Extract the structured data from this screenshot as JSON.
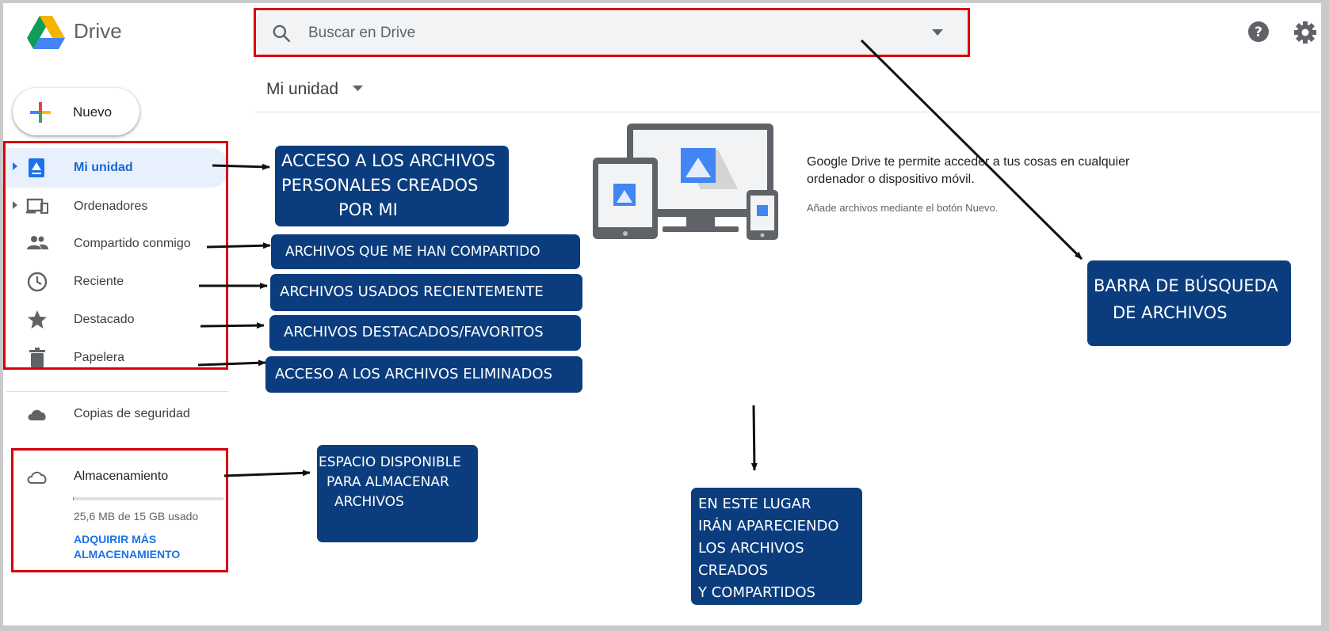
{
  "header": {
    "app_name": "Drive",
    "search_placeholder": "Buscar en Drive"
  },
  "new_button": {
    "label": "Nuevo"
  },
  "sidebar": {
    "items": [
      {
        "label": "Mi unidad",
        "icon": "my-drive-icon",
        "active": true
      },
      {
        "label": "Ordenadores",
        "icon": "computers-icon"
      },
      {
        "label": "Compartido conmigo",
        "icon": "shared-people-icon"
      },
      {
        "label": "Reciente",
        "icon": "clock-icon"
      },
      {
        "label": "Destacado",
        "icon": "star-icon"
      },
      {
        "label": "Papelera",
        "icon": "trash-icon"
      }
    ],
    "backups": {
      "label": "Copias de seguridad",
      "icon": "cloud-icon"
    },
    "storage": {
      "label": "Almacenamiento",
      "icon": "cloud-outline-icon",
      "usage_text": "25,6 MB de 15 GB usado",
      "used_fraction": 0.0017,
      "upgrade_line1": "ADQUIRIR MÁS",
      "upgrade_line2": "ALMACENAMIENTO"
    }
  },
  "main": {
    "breadcrumb": "Mi unidad",
    "empty_state": {
      "description": "Google Drive te permite acceder a tus cosas en cualquier ordenador o dispositivo móvil.",
      "hint": "Añade archivos mediante el botón Nuevo."
    }
  },
  "annotations": {
    "mydrive": [
      "ACCESO A LOS ARCHIVOS",
      "PERSONALES CREADOS",
      "POR MI"
    ],
    "shared": "ARCHIVOS QUE ME HAN COMPARTIDO",
    "recent": "ARCHIVOS USADOS RECIENTEMENTE",
    "starred": "ARCHIVOS DESTACADOS/FAVORITOS",
    "trash": "ACCESO A LOS ARCHIVOS ELIMINADOS",
    "storage": [
      "ESPACIO DISPONIBLE",
      "PARA ALMACENAR",
      "ARCHIVOS"
    ],
    "search": [
      "BARRA DE BÚSQUEDA",
      "DE ARCHIVOS"
    ],
    "files_area": [
      "EN ESTE LUGAR",
      "IRÁN APARECIENDO",
      "LOS ARCHIVOS",
      "CREADOS",
      "Y COMPARTIDOS"
    ]
  },
  "colors": {
    "callout_bg": "#0b3d7e",
    "highlight_red": "#d8000c",
    "drive_blue": "#4285f4",
    "drive_green": "#0f9d58",
    "drive_yellow": "#f4b400"
  }
}
